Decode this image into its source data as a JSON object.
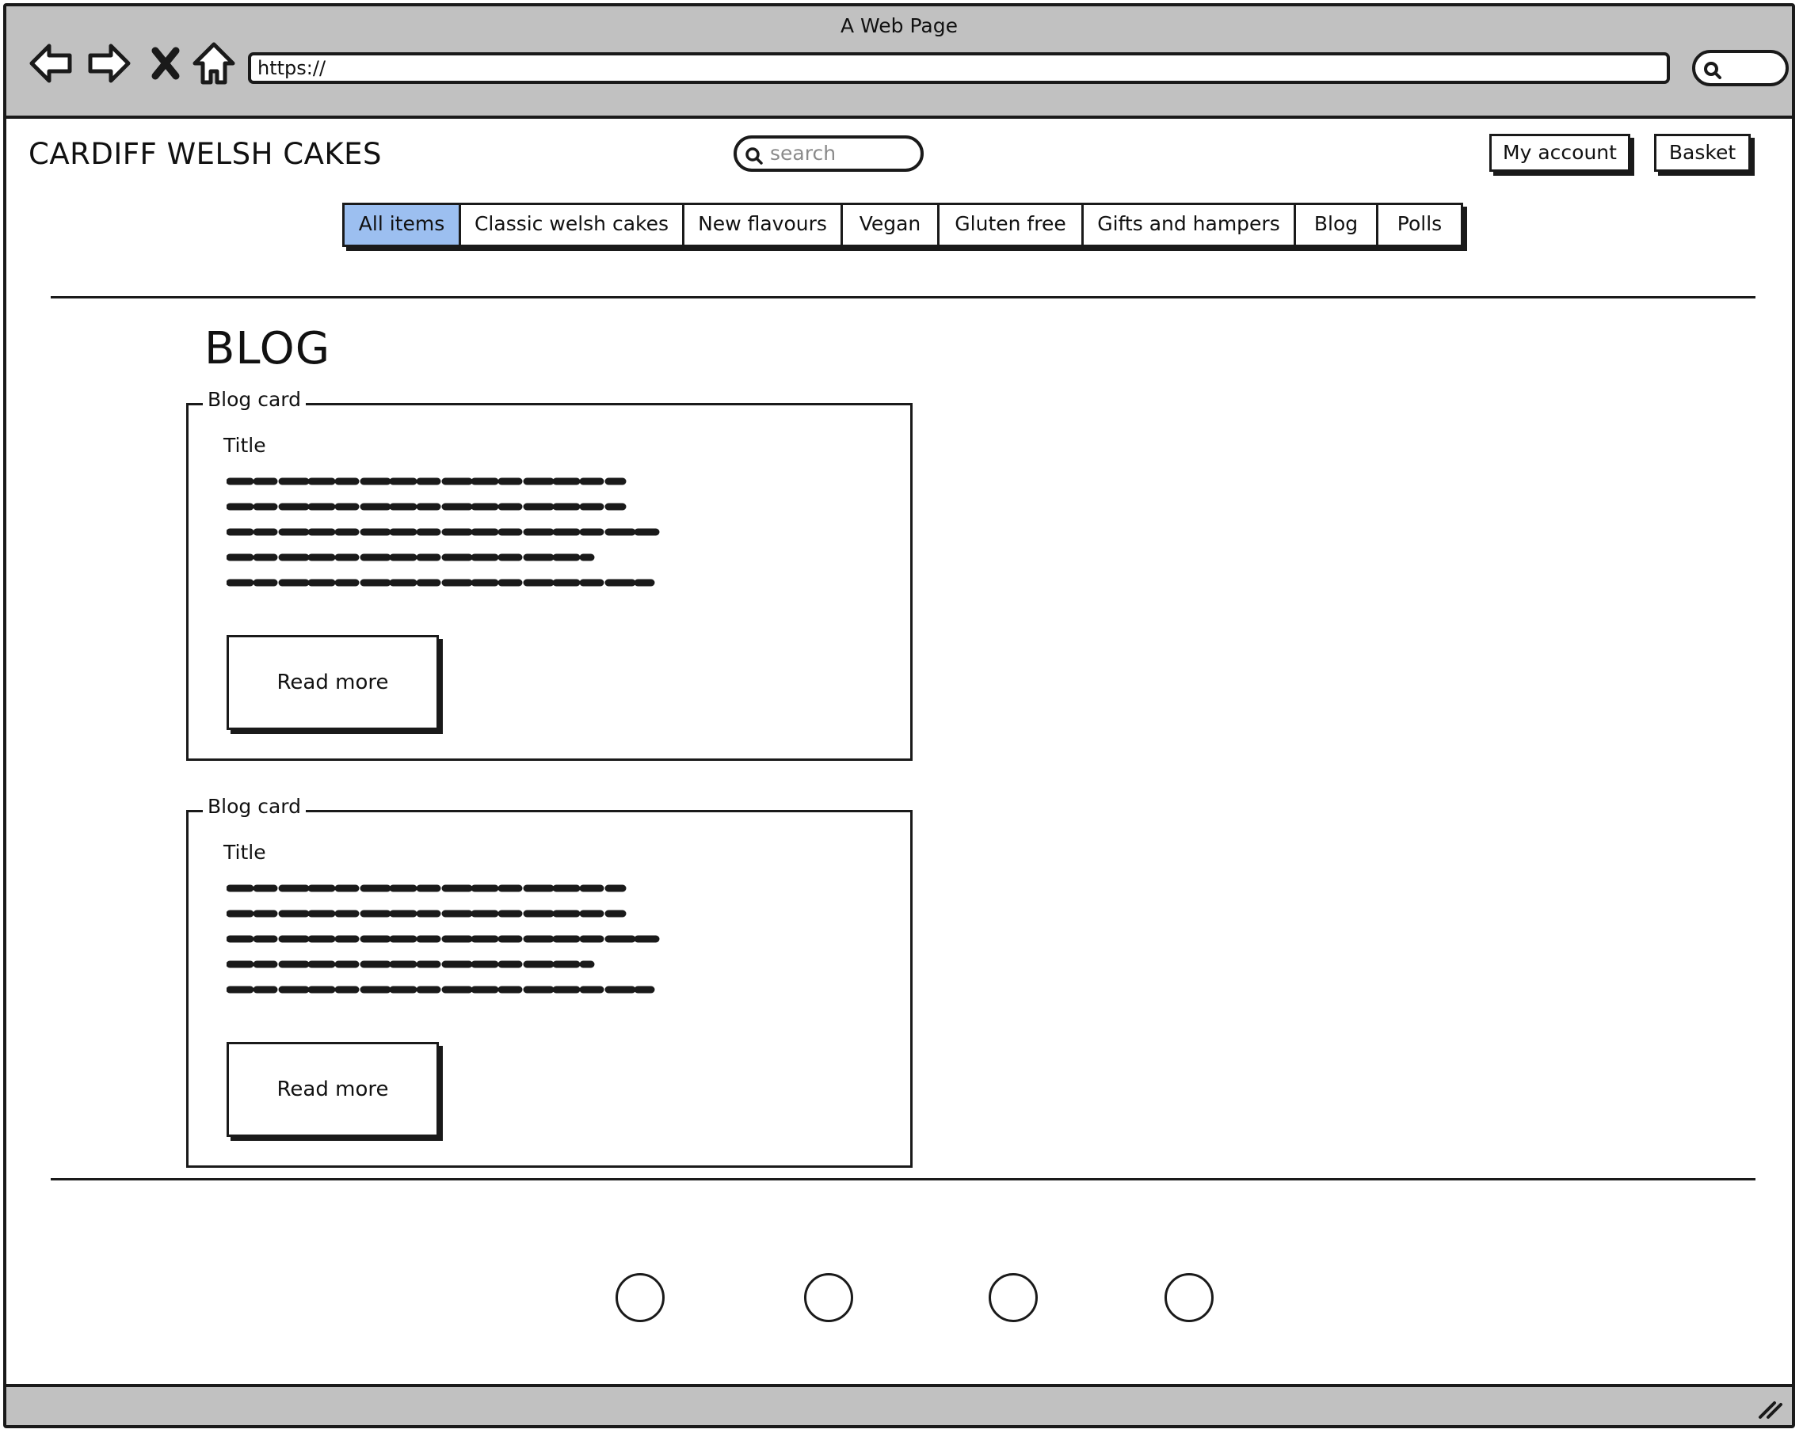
{
  "window": {
    "title": "A Web Page",
    "url": "https://",
    "icons": [
      "back-arrow-icon",
      "forward-arrow-icon",
      "close-icon",
      "home-icon",
      "search-icon",
      "resize-grip-icon"
    ]
  },
  "site": {
    "name": "CARDIFF WELSH CAKES",
    "search_placeholder": "search",
    "account_label": "My account",
    "basket_label": "Basket"
  },
  "nav": {
    "tabs": [
      {
        "label": "All items",
        "active": true
      },
      {
        "label": "Classic welsh cakes",
        "active": false
      },
      {
        "label": "New flavours",
        "active": false
      },
      {
        "label": "Vegan",
        "active": false
      },
      {
        "label": "Gluten free",
        "active": false
      },
      {
        "label": "Gifts and hampers",
        "active": false
      },
      {
        "label": "Blog",
        "active": false
      },
      {
        "label": "Polls",
        "active": false
      }
    ]
  },
  "main": {
    "heading": "BLOG",
    "cards": [
      {
        "legend": "Blog card",
        "title": "Title",
        "button_label": "Read more"
      },
      {
        "legend": "Blog card",
        "title": "Title",
        "button_label": "Read more"
      }
    ]
  },
  "colors": {
    "chrome_gray": "#c1c1c1",
    "active_tab": "#9cbff0",
    "ink": "#1a1a1a"
  }
}
